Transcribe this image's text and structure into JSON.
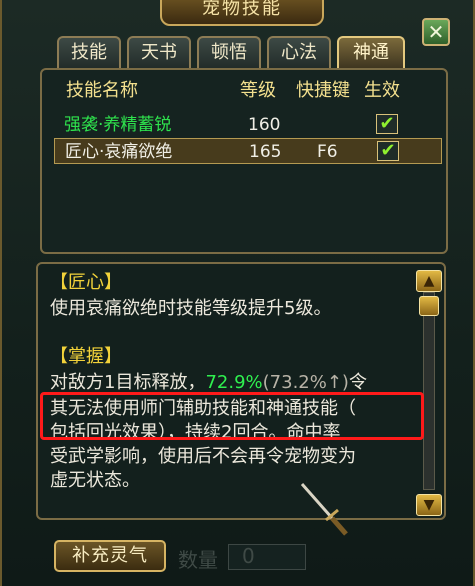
{
  "window": {
    "title": "宠物技能",
    "close_icon": "close-icon"
  },
  "tabs": [
    {
      "label": "技能",
      "active": false
    },
    {
      "label": "天书",
      "active": false
    },
    {
      "label": "顿悟",
      "active": false
    },
    {
      "label": "心法",
      "active": false
    },
    {
      "label": "神通",
      "active": true
    }
  ],
  "skill_table": {
    "headers": {
      "name": "技能名称",
      "level": "等级",
      "hotkey": "快捷键",
      "active": "生效"
    },
    "rows": [
      {
        "name": "强袭·养精蓄锐",
        "level": "160",
        "hotkey": "",
        "checked": true,
        "selected": false,
        "name_color": "#2ee24d"
      },
      {
        "name": "匠心·哀痛欲绝",
        "level": "165",
        "hotkey": "F6",
        "checked": true,
        "selected": true,
        "name_color": "#f0efe6"
      }
    ]
  },
  "description": {
    "section1_title": "【匠心】",
    "section1_text": "使用哀痛欲绝时技能等级提升5级。",
    "section2_title": "【掌握】",
    "line1_a": "对敌方1目标释放，",
    "line1_green": "72.9%",
    "line1_gray": "(73.2%↑)",
    "line1_b": "令",
    "line2": "其无法使用师门辅助技能和神通技能（",
    "line3": "包括回光效果），持续2回合。命中率",
    "line4": "受武学影响，使用后不会再令宠物变为",
    "line5": "虚无状态。"
  },
  "scrollbar": {
    "up_icon": "arrow-up-icon",
    "down_icon": "arrow-down-icon"
  },
  "footer": {
    "supplement_button": "补充灵气",
    "faded_label": "数量",
    "faded_value": "0"
  },
  "colors": {
    "accent_gold": "#c9a75b",
    "highlight_red": "#ff1a1a",
    "green_text": "#2ff04f"
  }
}
